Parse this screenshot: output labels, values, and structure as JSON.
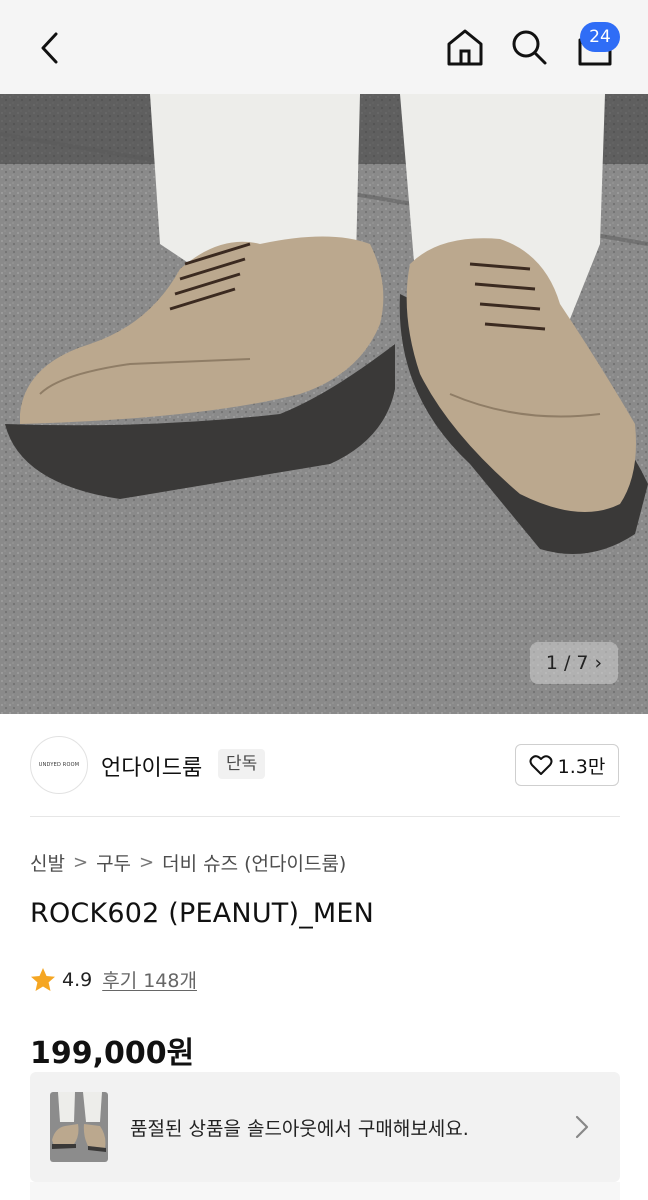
{
  "header": {
    "back_icon": "chevron-left-icon",
    "home_icon": "home-icon",
    "search_icon": "search-icon",
    "cart_icon": "cart-icon",
    "cart_count": "24"
  },
  "gallery": {
    "pager": "1 / 7 ›"
  },
  "seller": {
    "logo_text": "UNDYED ROOM",
    "name": "언다이드룸",
    "badge": "단독",
    "likes": "1.3만"
  },
  "product": {
    "breadcrumb": [
      "신발",
      "구두",
      "더비 슈즈 (언다이드룸)"
    ],
    "title": "ROCK602 (PEANUT)_MEN",
    "rating": "4.9",
    "reviews": "후기 148개",
    "price": "199,000원"
  },
  "soldout": {
    "text": "품절된 상품을 솔드아웃에서 구매해보세요."
  },
  "colors": {
    "badge": "#2f6df6",
    "star": "#f5a623"
  }
}
